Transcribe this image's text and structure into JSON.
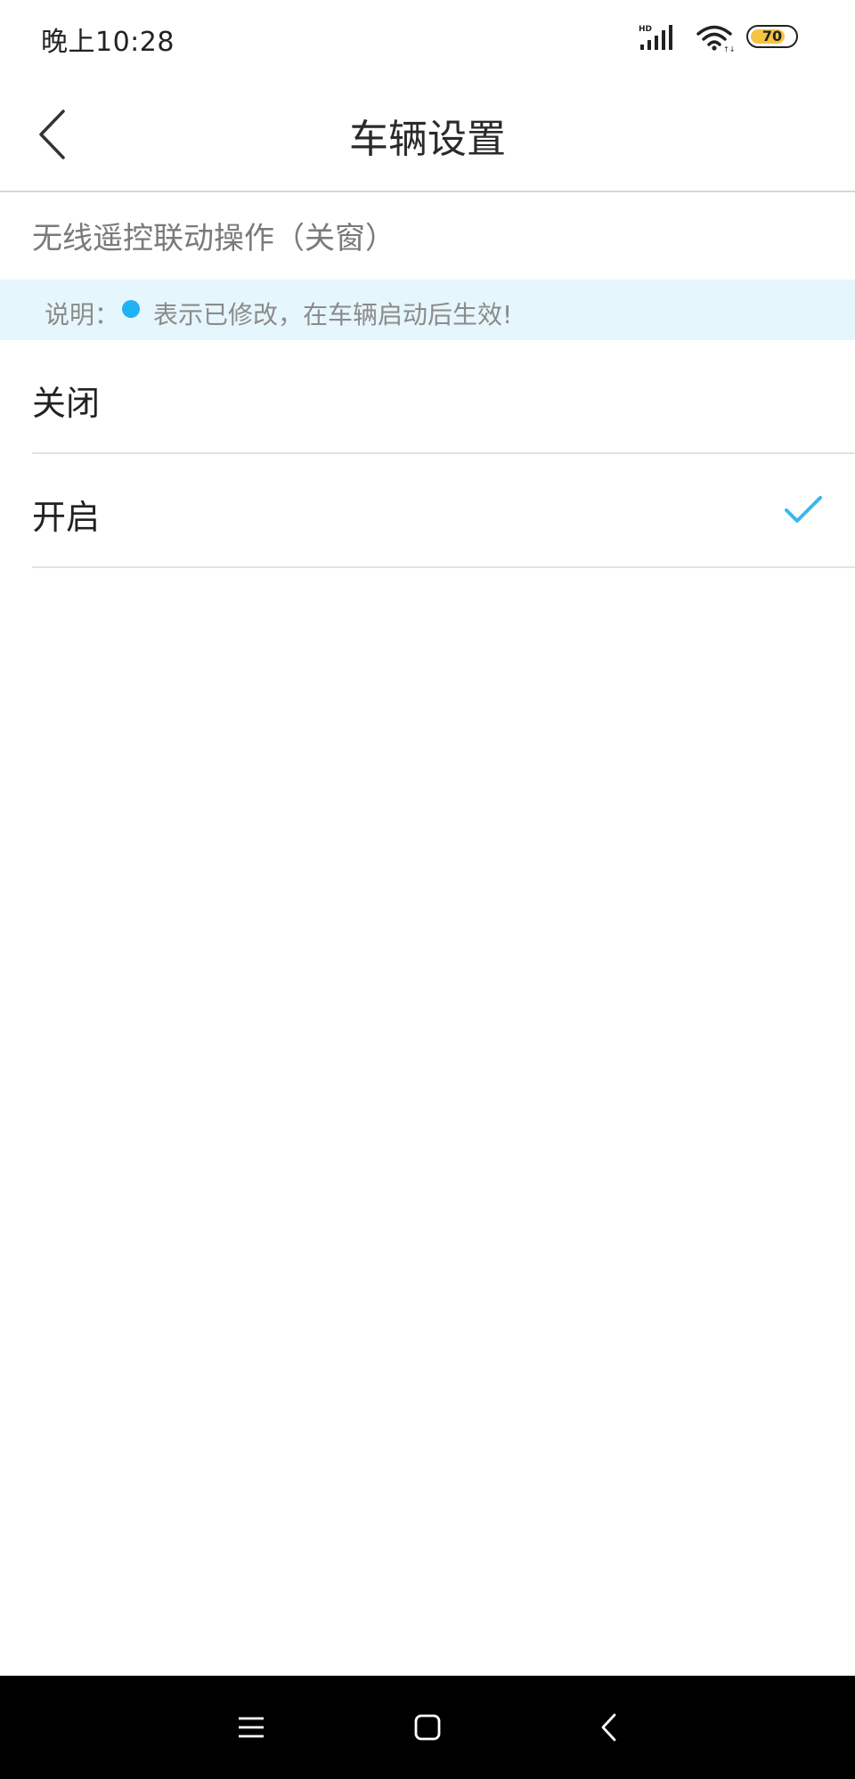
{
  "status_bar": {
    "time": "晚上10:28",
    "battery_level": "70",
    "battery_color": "#f6c343"
  },
  "header": {
    "title": "车辆设置",
    "back_icon": "chevron-left-icon"
  },
  "section": {
    "title": "无线遥控联动操作（关窗）"
  },
  "notice": {
    "label": "说明：",
    "text": "表示已修改，在车辆启动后生效!",
    "dot_color": "#20b3f3"
  },
  "options": [
    {
      "label": "关闭",
      "selected": false
    },
    {
      "label": "开启",
      "selected": true
    }
  ],
  "accent_color": "#3bb7ef",
  "nav_bar": {
    "icons": [
      "menu-icon",
      "home-icon",
      "back-icon"
    ]
  }
}
